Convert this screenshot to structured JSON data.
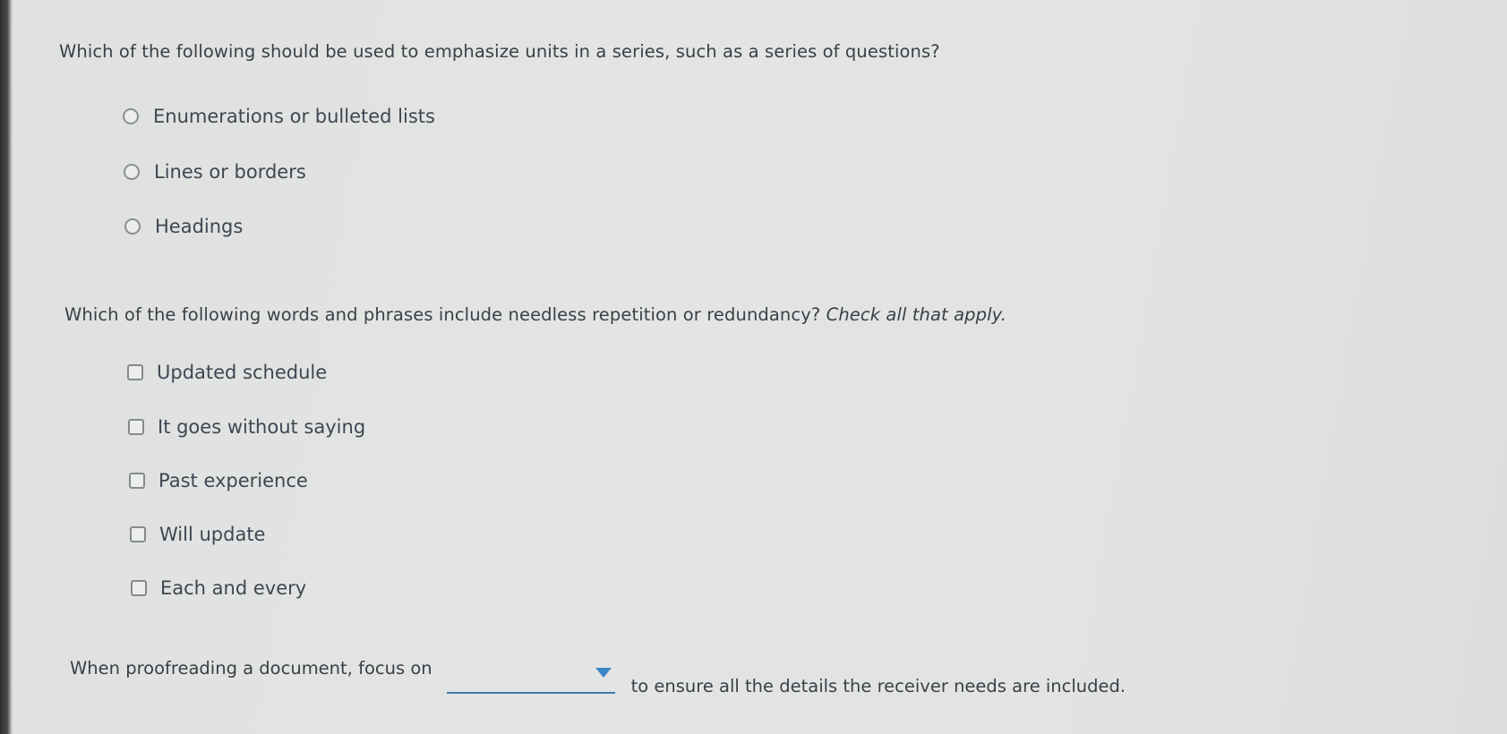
{
  "questions": [
    {
      "type": "single-choice",
      "prompt": "Which of the following should be used to emphasize units in a series, such as a series of questions?",
      "options": [
        {
          "label": "Enumerations or bulleted lists",
          "selected": false
        },
        {
          "label": "Lines or borders",
          "selected": false
        },
        {
          "label": "Headings",
          "selected": false
        }
      ]
    },
    {
      "type": "multiple-choice",
      "prompt": "Which of the following words and phrases include needless repetition or redundancy?",
      "instruction": "Check all that apply.",
      "options": [
        {
          "label": "Updated schedule",
          "checked": false
        },
        {
          "label": "It goes without saying",
          "checked": false
        },
        {
          "label": "Past experience",
          "checked": false
        },
        {
          "label": "Will update",
          "checked": false
        },
        {
          "label": "Each and every",
          "checked": false
        }
      ]
    },
    {
      "type": "fill-in-dropdown",
      "before_text": "When proofreading a document, focus on",
      "selected_value": "",
      "after_text": "to ensure all the details the receiver needs are included."
    }
  ],
  "colors": {
    "dropdown_accent": "#3c86c6",
    "text": "#3b3f46"
  }
}
